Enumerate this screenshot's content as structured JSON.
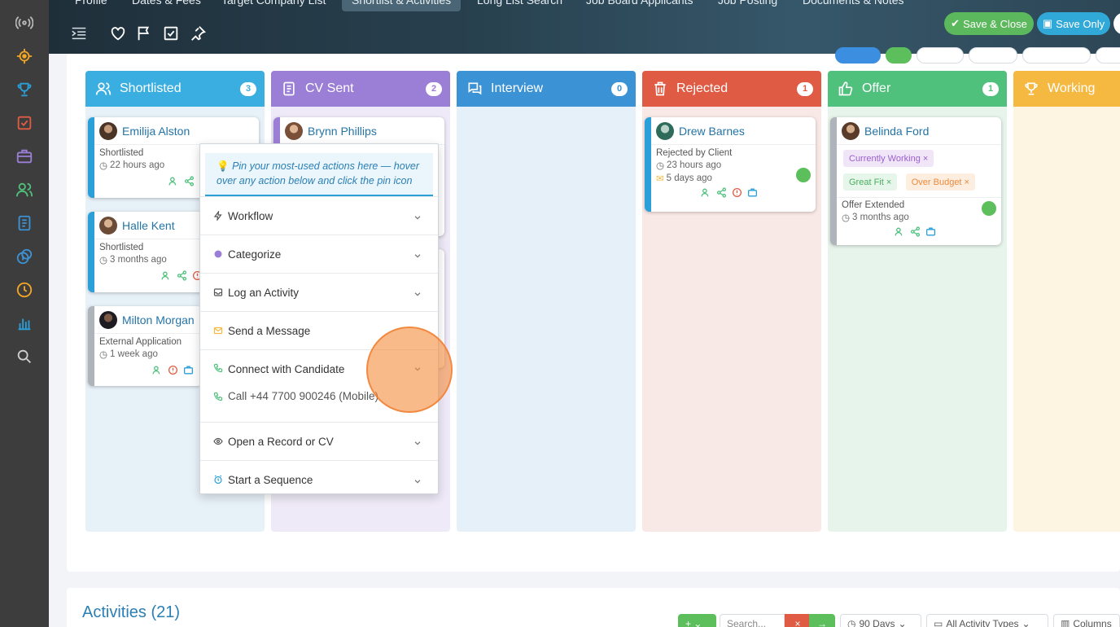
{
  "header": {
    "tabs": [
      "Profile",
      "Dates & Fees",
      "Target Company List",
      "Shortlist & Activities",
      "Long List Search",
      "Job Board Applicants",
      "Job Posting",
      "Documents & Notes"
    ],
    "active_tab": "Shortlist & Activities",
    "save_close_label": "Save & Close",
    "save_only_label": "Save Only"
  },
  "board": {
    "columns": [
      {
        "title": "Shortlisted",
        "count": "3",
        "color": "#3aaee0"
      },
      {
        "title": "CV Sent",
        "count": "2",
        "color": "#9b7fd6"
      },
      {
        "title": "Interview",
        "count": "0",
        "color": "#3b93d6"
      },
      {
        "title": "Rejected",
        "count": "1",
        "color": "#e05b44"
      },
      {
        "title": "Offer",
        "count": "1",
        "color": "#4fc17d"
      },
      {
        "title": "Working",
        "count": "",
        "color": "#f5b942"
      }
    ],
    "cards": {
      "emilija": {
        "name": "Emilija Alston",
        "status": "Shortlisted",
        "time": "22 hours ago"
      },
      "halle": {
        "name": "Halle Kent",
        "status": "Shortlisted",
        "time": "3 months ago"
      },
      "milton": {
        "name": "Milton Morgan",
        "status": "External Application",
        "time": "1 week ago"
      },
      "brynn": {
        "name": "Brynn Phillips"
      },
      "drew": {
        "name": "Drew Barnes",
        "status": "Rejected by Client",
        "time": "23 hours ago",
        "time2": "5 days ago"
      },
      "belinda": {
        "name": "Belinda Ford",
        "tags": [
          "Currently Working",
          "Great Fit",
          "Over Budget"
        ],
        "status": "Offer Extended",
        "time": "3 months ago"
      }
    }
  },
  "popup": {
    "pin_note": "Pin your most-used actions here — hover over any action below and click the pin icon",
    "items": [
      "Workflow",
      "Categorize",
      "Log an Activity",
      "Send a Message",
      "Connect with Candidate",
      "Open a Record or CV",
      "Start a Sequence"
    ],
    "call_label": "Call +44 7700 900246 (Mobile)"
  },
  "activities": {
    "title": "Activities (21)",
    "search_placeholder": "Search...",
    "range_label": "90 Days",
    "types_label": "All Activity Types",
    "columns_label": "Columns"
  },
  "colors": {
    "accent": "#2a9fd8",
    "green": "#5cb85c",
    "orange_highlight": "#f58c3c"
  }
}
